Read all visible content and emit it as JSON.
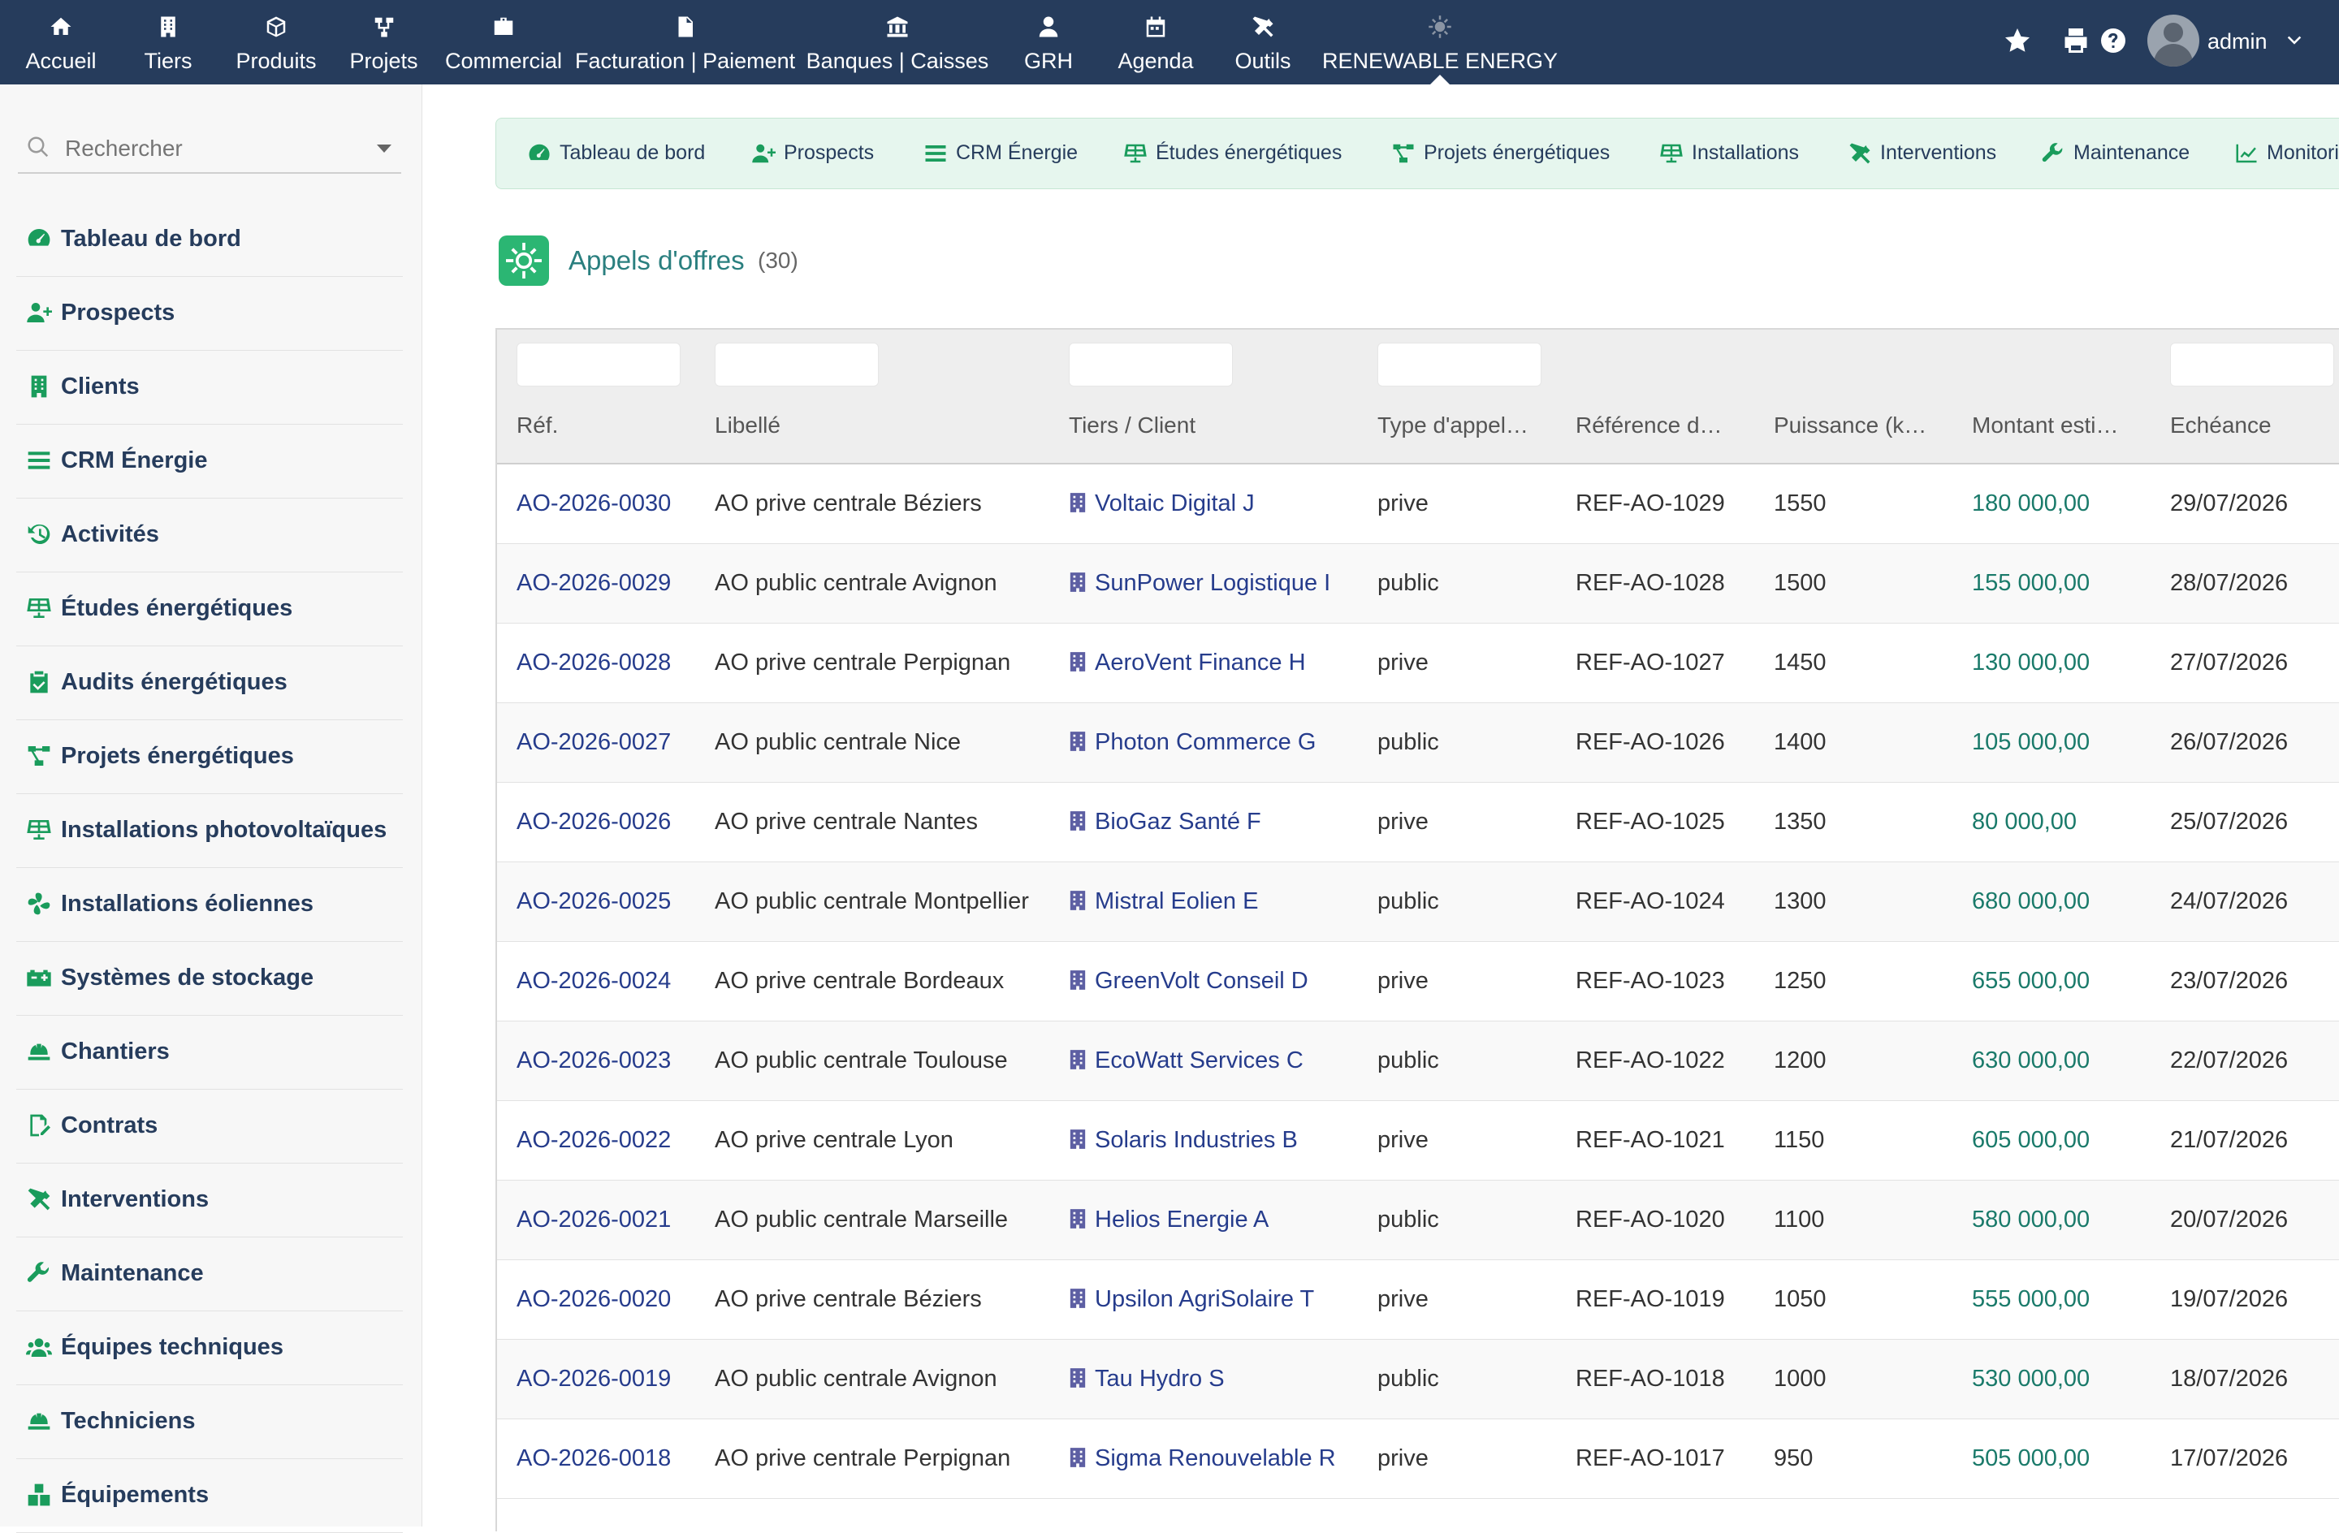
{
  "topbar": {
    "menu": [
      {
        "label": "Accueil",
        "icon": "home-icon"
      },
      {
        "label": "Tiers",
        "icon": "building-icon"
      },
      {
        "label": "Produits",
        "icon": "cube-icon"
      },
      {
        "label": "Projets",
        "icon": "sitemap-icon"
      },
      {
        "label": "Commercial",
        "icon": "briefcase-icon"
      },
      {
        "label": "Facturation | Paiement",
        "icon": "invoice-icon"
      },
      {
        "label": "Banques | Caisses",
        "icon": "bank-icon"
      },
      {
        "label": "GRH",
        "icon": "user-tie-icon"
      },
      {
        "label": "Agenda",
        "icon": "calendar-icon"
      },
      {
        "label": "Outils",
        "icon": "tools-icon"
      },
      {
        "label": "RENEWABLE ENERGY",
        "icon": "sun-icon"
      }
    ],
    "username": "admin"
  },
  "sidebar": {
    "search_placeholder": "Rechercher",
    "items": [
      {
        "label": "Tableau de bord",
        "icon": "dashboard-icon"
      },
      {
        "label": "Prospects",
        "icon": "user-plus-icon"
      },
      {
        "label": "Clients",
        "icon": "building-icon"
      },
      {
        "label": "CRM Énergie",
        "icon": "list-icon"
      },
      {
        "label": "Activités",
        "icon": "history-icon"
      },
      {
        "label": "Études énergétiques",
        "icon": "solar-panel-icon"
      },
      {
        "label": "Audits énergétiques",
        "icon": "clipboard-check-icon"
      },
      {
        "label": "Projets énergétiques",
        "icon": "project-diagram-icon"
      },
      {
        "label": "Installations photovoltaïques",
        "icon": "solar-panel-icon"
      },
      {
        "label": "Installations éoliennes",
        "icon": "wind-fan-icon"
      },
      {
        "label": "Systèmes de stockage",
        "icon": "battery-icon"
      },
      {
        "label": "Chantiers",
        "icon": "hard-hat-icon"
      },
      {
        "label": "Contrats",
        "icon": "contract-icon"
      },
      {
        "label": "Interventions",
        "icon": "tools-icon"
      },
      {
        "label": "Maintenance",
        "icon": "wrench-icon"
      },
      {
        "label": "Équipes techniques",
        "icon": "users-icon"
      },
      {
        "label": "Techniciens",
        "icon": "hard-hat-icon"
      },
      {
        "label": "Équipements",
        "icon": "boxes-icon"
      }
    ]
  },
  "tabs": [
    {
      "label": "Tableau de bord",
      "icon": "dashboard-icon"
    },
    {
      "label": "Prospects",
      "icon": "user-plus-icon"
    },
    {
      "label": "CRM Énergie",
      "icon": "list-icon"
    },
    {
      "label": "Études énergétiques",
      "icon": "solar-panel-icon"
    },
    {
      "label": "Projets énergétiques",
      "icon": "project-diagram-icon"
    },
    {
      "label": "Installations",
      "icon": "solar-panel-icon"
    },
    {
      "label": "Interventions",
      "icon": "tools-icon"
    },
    {
      "label": "Maintenance",
      "icon": "wrench-icon"
    },
    {
      "label": "Monitori",
      "icon": "chart-line-icon"
    }
  ],
  "page": {
    "title": "Appels d'offres",
    "count": "(30)"
  },
  "table": {
    "headers": [
      "Réf.",
      "Libellé",
      "Tiers / Client",
      "Type d'appel…",
      "Référence d…",
      "Puissance (k…",
      "Montant esti…",
      "Echéance"
    ],
    "rows": [
      {
        "ref": "AO-2026-0030",
        "label": "AO prive centrale Béziers",
        "client": "Voltaic Digital J",
        "type": "prive",
        "reference": "REF-AO-1029",
        "power": "1550",
        "amount": "180 000,00",
        "due": "29/07/2026"
      },
      {
        "ref": "AO-2026-0029",
        "label": "AO public centrale Avignon",
        "client": "SunPower Logistique I",
        "type": "public",
        "reference": "REF-AO-1028",
        "power": "1500",
        "amount": "155 000,00",
        "due": "28/07/2026"
      },
      {
        "ref": "AO-2026-0028",
        "label": "AO prive centrale Perpignan",
        "client": "AeroVent Finance H",
        "type": "prive",
        "reference": "REF-AO-1027",
        "power": "1450",
        "amount": "130 000,00",
        "due": "27/07/2026"
      },
      {
        "ref": "AO-2026-0027",
        "label": "AO public centrale Nice",
        "client": "Photon Commerce G",
        "type": "public",
        "reference": "REF-AO-1026",
        "power": "1400",
        "amount": "105 000,00",
        "due": "26/07/2026"
      },
      {
        "ref": "AO-2026-0026",
        "label": "AO prive centrale Nantes",
        "client": "BioGaz Santé F",
        "type": "prive",
        "reference": "REF-AO-1025",
        "power": "1350",
        "amount": "80 000,00",
        "due": "25/07/2026"
      },
      {
        "ref": "AO-2026-0025",
        "label": "AO public centrale Montpellier",
        "client": "Mistral Eolien E",
        "type": "public",
        "reference": "REF-AO-1024",
        "power": "1300",
        "amount": "680 000,00",
        "due": "24/07/2026"
      },
      {
        "ref": "AO-2026-0024",
        "label": "AO prive centrale Bordeaux",
        "client": "GreenVolt Conseil D",
        "type": "prive",
        "reference": "REF-AO-1023",
        "power": "1250",
        "amount": "655 000,00",
        "due": "23/07/2026"
      },
      {
        "ref": "AO-2026-0023",
        "label": "AO public centrale Toulouse",
        "client": "EcoWatt Services C",
        "type": "public",
        "reference": "REF-AO-1022",
        "power": "1200",
        "amount": "630 000,00",
        "due": "22/07/2026"
      },
      {
        "ref": "AO-2026-0022",
        "label": "AO prive centrale Lyon",
        "client": "Solaris Industries B",
        "type": "prive",
        "reference": "REF-AO-1021",
        "power": "1150",
        "amount": "605 000,00",
        "due": "21/07/2026"
      },
      {
        "ref": "AO-2026-0021",
        "label": "AO public centrale Marseille",
        "client": "Helios Energie A",
        "type": "public",
        "reference": "REF-AO-1020",
        "power": "1100",
        "amount": "580 000,00",
        "due": "20/07/2026"
      },
      {
        "ref": "AO-2026-0020",
        "label": "AO prive centrale Béziers",
        "client": "Upsilon AgriSolaire T",
        "type": "prive",
        "reference": "REF-AO-1019",
        "power": "1050",
        "amount": "555 000,00",
        "due": "19/07/2026"
      },
      {
        "ref": "AO-2026-0019",
        "label": "AO public centrale Avignon",
        "client": "Tau Hydro S",
        "type": "public",
        "reference": "REF-AO-1018",
        "power": "1000",
        "amount": "530 000,00",
        "due": "18/07/2026"
      },
      {
        "ref": "AO-2026-0018",
        "label": "AO prive centrale Perpignan",
        "client": "Sigma Renouvelable R",
        "type": "prive",
        "reference": "REF-AO-1017",
        "power": "950",
        "amount": "505 000,00",
        "due": "17/07/2026"
      }
    ]
  },
  "colors": {
    "topbar": "#263c5c",
    "accent_green": "#1a9c5c",
    "link_blue": "#263c8c",
    "amount_teal": "#1a7a6a"
  }
}
